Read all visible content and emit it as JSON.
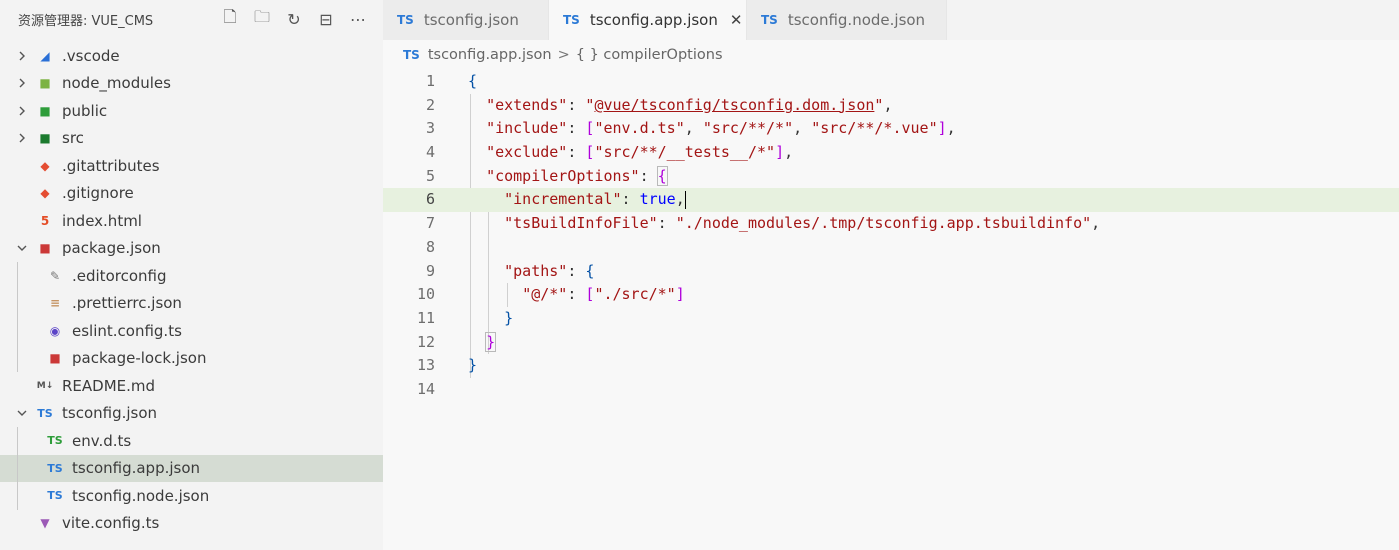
{
  "explorer": {
    "title": "资源管理器: VUE_CMS",
    "actions": [
      {
        "name": "new-file-icon",
        "glyph": "🗋"
      },
      {
        "name": "new-folder-icon",
        "glyph": "🗀"
      },
      {
        "name": "refresh-icon",
        "glyph": "↻"
      },
      {
        "name": "collapse-all-icon",
        "glyph": "⊟"
      },
      {
        "name": "more-icon",
        "glyph": "⋯"
      }
    ],
    "items": [
      {
        "label": ".vscode",
        "type": "folder",
        "expanded": false,
        "depth": 0,
        "icon": "vscode-folder-icon",
        "color": "#2a6fd6",
        "glyph": "◢"
      },
      {
        "label": "node_modules",
        "type": "folder",
        "expanded": false,
        "depth": 0,
        "icon": "node-folder-icon",
        "color": "#7cb342",
        "glyph": "■"
      },
      {
        "label": "public",
        "type": "folder",
        "expanded": false,
        "depth": 0,
        "icon": "public-folder-icon",
        "color": "#2e9d3a",
        "glyph": "■"
      },
      {
        "label": "src",
        "type": "folder",
        "expanded": false,
        "depth": 0,
        "icon": "src-folder-icon",
        "color": "#1b7a2e",
        "glyph": "■"
      },
      {
        "label": ".gitattributes",
        "type": "file",
        "depth": 0,
        "icon": "git-icon",
        "color": "#e44d32",
        "glyph": "◆"
      },
      {
        "label": ".gitignore",
        "type": "file",
        "depth": 0,
        "icon": "git-icon",
        "color": "#e44d32",
        "glyph": "◆"
      },
      {
        "label": "index.html",
        "type": "file",
        "depth": 0,
        "icon": "html-icon",
        "color": "#e44d26",
        "glyph": "5"
      },
      {
        "label": "package.json",
        "type": "folder",
        "expanded": true,
        "depth": 0,
        "icon": "npm-icon",
        "color": "#cb3837",
        "glyph": "■"
      },
      {
        "label": ".editorconfig",
        "type": "file",
        "depth": 1,
        "icon": "editorconfig-icon",
        "color": "#777777",
        "glyph": "✎"
      },
      {
        "label": ".prettierrc.json",
        "type": "file",
        "depth": 1,
        "icon": "prettier-icon",
        "color": "#c59464",
        "glyph": "≡"
      },
      {
        "label": "eslint.config.ts",
        "type": "file",
        "depth": 1,
        "icon": "eslint-icon",
        "color": "#5b43c7",
        "glyph": "◉"
      },
      {
        "label": "package-lock.json",
        "type": "file",
        "depth": 1,
        "icon": "npm-icon",
        "color": "#cb3837",
        "glyph": "■"
      },
      {
        "label": "README.md",
        "type": "file",
        "depth": 0,
        "icon": "markdown-icon",
        "color": "#555555",
        "glyph": "M↓"
      },
      {
        "label": "tsconfig.json",
        "type": "folder",
        "expanded": true,
        "depth": 0,
        "icon": "ts-icon",
        "color": "#2c7ad6",
        "glyph": "TS"
      },
      {
        "label": "env.d.ts",
        "type": "file",
        "depth": 1,
        "icon": "ts-green-icon",
        "color": "#2e9d3a",
        "glyph": "TS"
      },
      {
        "label": "tsconfig.app.json",
        "type": "file",
        "depth": 1,
        "icon": "ts-icon",
        "color": "#2c7ad6",
        "glyph": "TS",
        "selected": true
      },
      {
        "label": "tsconfig.node.json",
        "type": "file",
        "depth": 1,
        "icon": "ts-icon",
        "color": "#2c7ad6",
        "glyph": "TS"
      },
      {
        "label": "vite.config.ts",
        "type": "file",
        "depth": 0,
        "icon": "vite-icon",
        "color": "#9b59b6",
        "glyph": "▼"
      }
    ]
  },
  "tabs": [
    {
      "label": "tsconfig.json",
      "active": false
    },
    {
      "label": "tsconfig.app.json",
      "active": true,
      "close": "✕"
    },
    {
      "label": "tsconfig.node.json",
      "active": false
    }
  ],
  "breadcrumb": {
    "file": "tsconfig.app.json",
    "separator": ">",
    "symbol": "{ } compilerOptions"
  },
  "code": {
    "line_numbers": [
      "1",
      "2",
      "3",
      "4",
      "5",
      "6",
      "7",
      "8",
      "9",
      "10",
      "11",
      "12",
      "13",
      "14"
    ],
    "current_line": 6
  }
}
